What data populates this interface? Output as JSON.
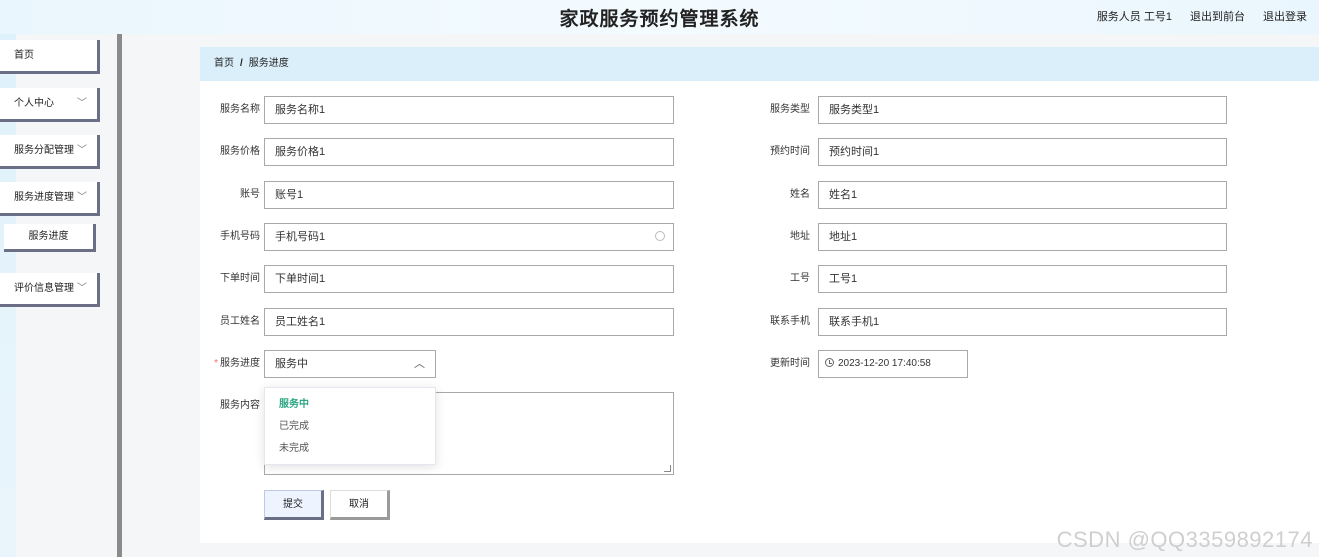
{
  "header": {
    "title": "家政服务预约管理系统",
    "user_role": "服务人员 工号1",
    "front_link": "退出到前台",
    "logout_link": "退出登录"
  },
  "sidebar": {
    "items": [
      {
        "label": "首页"
      },
      {
        "label": "个人中心"
      },
      {
        "label": "服务分配管理"
      },
      {
        "label": "服务进度管理"
      },
      {
        "label": "评价信息管理"
      }
    ],
    "sub_item": "服务进度"
  },
  "breadcrumb": {
    "home": "首页",
    "separator": "/",
    "current": "服务进度"
  },
  "form": {
    "service_name": {
      "label": "服务名称",
      "value": "服务名称1"
    },
    "service_type": {
      "label": "服务类型",
      "value": "服务类型1"
    },
    "service_price": {
      "label": "服务价格",
      "value": "服务价格1"
    },
    "booking_time": {
      "label": "预约时间",
      "value": "预约时间1"
    },
    "account": {
      "label": "账号",
      "value": "账号1"
    },
    "name": {
      "label": "姓名",
      "value": "姓名1"
    },
    "phone": {
      "label": "手机号码",
      "value": "手机号码1"
    },
    "address": {
      "label": "地址",
      "value": "地址1"
    },
    "order_time": {
      "label": "下单时间",
      "value": "下单时间1"
    },
    "staff_no": {
      "label": "工号",
      "value": "工号1"
    },
    "staff_name": {
      "label": "员工姓名",
      "value": "员工姓名1"
    },
    "contact_phone": {
      "label": "联系手机",
      "value": "联系手机1"
    },
    "progress": {
      "label": "服务进度",
      "required_mark": "*",
      "value": "服务中",
      "options": [
        "服务中",
        "已完成",
        "未完成"
      ]
    },
    "update_time": {
      "label": "更新时间",
      "value": "2023-12-20 17:40:58"
    },
    "content": {
      "label": "服务内容",
      "value": ""
    }
  },
  "buttons": {
    "submit": "提交",
    "cancel": "取消"
  },
  "watermark": "CSDN @QQ3359892174"
}
